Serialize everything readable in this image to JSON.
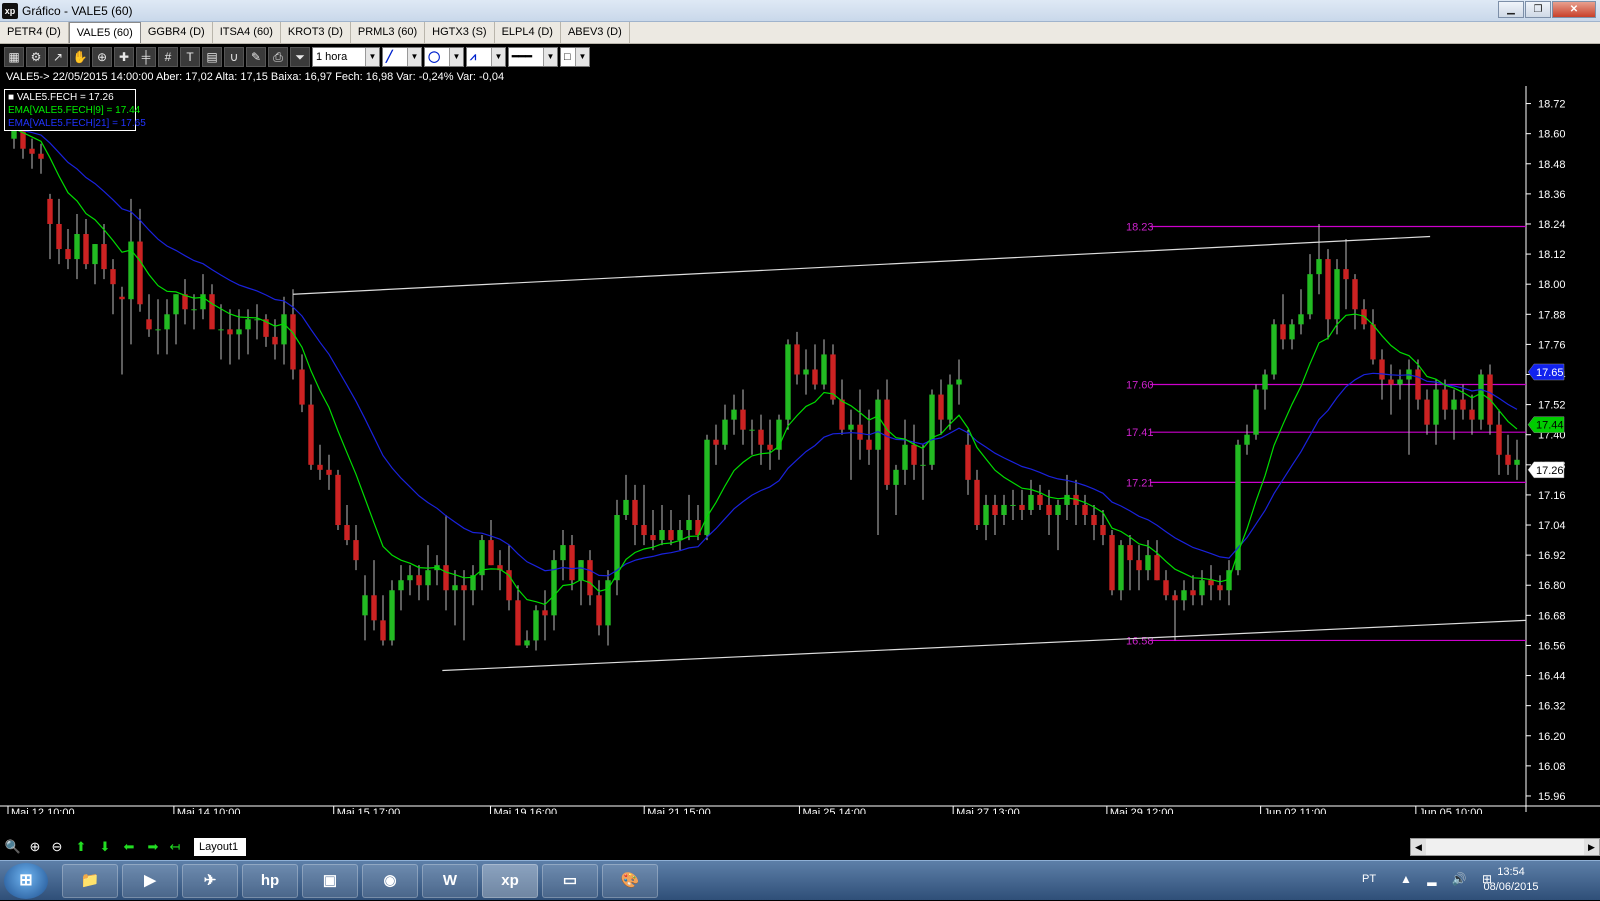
{
  "window": {
    "title": "Gráfico - VALE5 (60)",
    "logo": "xp"
  },
  "tabs": [
    {
      "label": "PETR4 (D)",
      "active": false
    },
    {
      "label": "VALE5 (60)",
      "active": true
    },
    {
      "label": "GGBR4 (D)",
      "active": false
    },
    {
      "label": "ITSA4 (60)",
      "active": false
    },
    {
      "label": "KROT3 (D)",
      "active": false
    },
    {
      "label": "PRML3 (60)",
      "active": false
    },
    {
      "label": "HGTX3 (S)",
      "active": false
    },
    {
      "label": "ELPL4 (D)",
      "active": false
    },
    {
      "label": "ABEV3 (D)",
      "active": false
    }
  ],
  "toolbar": {
    "interval": "1 hora"
  },
  "info_line": "VALE5-> 22/05/2015 14:00:00 Aber: 17,02 Alta: 17,15 Baixa: 16,97 Fech: 16,98 Var: -0,24% Var: -0,04",
  "legend": [
    {
      "text": "■ VALE5.FECH = 17.26",
      "color": "#ffffff"
    },
    {
      "text": "EMA[VALE5.FECH|9] = 17.44",
      "color": "#00ee00"
    },
    {
      "text": "EMA[VALE5.FECH|21] = 17.65",
      "color": "#2233ff"
    }
  ],
  "bottom": {
    "layout_tab": "Layout1"
  },
  "tray": {
    "lang": "PT",
    "time": "13:54",
    "date": "08/06/2015"
  },
  "chart_data": {
    "type": "candlestick",
    "y_ticks": [
      "18.72",
      "18.60",
      "18.48",
      "18.36",
      "18.24",
      "18.12",
      "18.00",
      "17.88",
      "17.76",
      "17.64",
      "17.52",
      "17.40",
      "17.28",
      "17.16",
      "17.04",
      "16.92",
      "16.80",
      "16.68",
      "16.56",
      "16.44",
      "16.32",
      "16.20",
      "16.08",
      "15.96"
    ],
    "ylim": [
      15.92,
      18.79
    ],
    "x_labels": [
      "Mai 12 10:00",
      "Mai 14 10:00",
      "Mai 15 17:00",
      "Mai 19 16:00",
      "Mai 21 15:00",
      "Mai 25 14:00",
      "Mai 27 13:00",
      "Mai 29 12:00",
      "Jun 02 11:00",
      "Jun 05 10:00"
    ],
    "h_levels": [
      {
        "value": 18.23,
        "label": "18.23"
      },
      {
        "value": 17.6,
        "label": "17.60"
      },
      {
        "value": 17.41,
        "label": "17.41"
      },
      {
        "value": 17.21,
        "label": "17.21"
      },
      {
        "value": 16.58,
        "label": "16.58"
      }
    ],
    "price_badges": [
      {
        "value": 17.65,
        "label": "17.65",
        "bg": "#1122ee",
        "fg": "#ffffff"
      },
      {
        "value": 17.44,
        "label": "17.44",
        "bg": "#00cc00",
        "fg": "#000000"
      },
      {
        "value": 17.26,
        "label": "17.26",
        "bg": "#ffffff",
        "fg": "#000000"
      }
    ],
    "trendlines": [
      {
        "x1": 0.19,
        "y1": 17.96,
        "x2": 0.937,
        "y2": 18.19
      },
      {
        "x1": 0.288,
        "y1": 16.46,
        "x2": 1.0,
        "y2": 16.66
      }
    ],
    "candles": [
      [
        18.58,
        18.66,
        18.54,
        18.62
      ],
      [
        18.62,
        18.68,
        18.5,
        18.54
      ],
      [
        18.54,
        18.58,
        18.46,
        18.52
      ],
      [
        18.52,
        18.56,
        18.44,
        18.5
      ],
      [
        18.34,
        18.36,
        18.1,
        18.24
      ],
      [
        18.24,
        18.34,
        18.08,
        18.14
      ],
      [
        18.14,
        18.22,
        18.06,
        18.1
      ],
      [
        18.1,
        18.28,
        18.02,
        18.2
      ],
      [
        18.2,
        18.26,
        18.06,
        18.08
      ],
      [
        18.08,
        18.16,
        18.0,
        18.16
      ],
      [
        18.16,
        18.24,
        18.02,
        18.06
      ],
      [
        18.06,
        18.1,
        17.88,
        18.0
      ],
      [
        17.95,
        17.99,
        17.64,
        17.94
      ],
      [
        17.94,
        18.34,
        17.76,
        18.17
      ],
      [
        18.17,
        18.3,
        17.89,
        17.92
      ],
      [
        17.86,
        17.96,
        17.79,
        17.82
      ],
      [
        17.82,
        17.94,
        17.72,
        17.82
      ],
      [
        17.82,
        17.94,
        17.72,
        17.88
      ],
      [
        17.88,
        17.96,
        17.76,
        17.96
      ],
      [
        17.96,
        18.02,
        17.84,
        17.9
      ],
      [
        17.9,
        17.96,
        17.82,
        17.9
      ],
      [
        17.9,
        18.04,
        17.86,
        17.96
      ],
      [
        17.96,
        18.0,
        17.84,
        17.82
      ],
      [
        17.82,
        17.92,
        17.7,
        17.82
      ],
      [
        17.82,
        17.9,
        17.68,
        17.8
      ],
      [
        17.8,
        17.9,
        17.7,
        17.82
      ],
      [
        17.82,
        17.9,
        17.72,
        17.86
      ],
      [
        17.86,
        17.92,
        17.78,
        17.86
      ],
      [
        17.86,
        17.88,
        17.75,
        17.79
      ],
      [
        17.79,
        17.86,
        17.7,
        17.76
      ],
      [
        17.76,
        17.95,
        17.68,
        17.88
      ],
      [
        17.88,
        17.98,
        17.62,
        17.66
      ],
      [
        17.66,
        17.72,
        17.49,
        17.52
      ],
      [
        17.52,
        17.6,
        17.26,
        17.28
      ],
      [
        17.28,
        17.36,
        17.22,
        17.26
      ],
      [
        17.26,
        17.32,
        17.18,
        17.24
      ],
      [
        17.24,
        17.26,
        17.02,
        17.04
      ],
      [
        17.04,
        17.12,
        16.96,
        16.98
      ],
      [
        16.98,
        17.04,
        16.86,
        16.9
      ],
      [
        16.68,
        16.84,
        16.58,
        16.76
      ],
      [
        16.76,
        16.9,
        16.62,
        16.66
      ],
      [
        16.66,
        16.76,
        16.56,
        16.58
      ],
      [
        16.58,
        16.82,
        16.56,
        16.78
      ],
      [
        16.78,
        16.88,
        16.7,
        16.82
      ],
      [
        16.82,
        16.88,
        16.76,
        16.84
      ],
      [
        16.84,
        16.88,
        16.74,
        16.8
      ],
      [
        16.8,
        16.96,
        16.74,
        16.86
      ],
      [
        16.86,
        16.92,
        16.8,
        16.88
      ],
      [
        16.88,
        17.08,
        16.7,
        16.78
      ],
      [
        16.78,
        16.86,
        16.64,
        16.8
      ],
      [
        16.8,
        16.86,
        16.58,
        16.78
      ],
      [
        16.78,
        16.88,
        16.72,
        16.84
      ],
      [
        16.84,
        17.0,
        16.78,
        16.98
      ],
      [
        16.98,
        17.06,
        16.88,
        16.88
      ],
      [
        16.88,
        16.94,
        16.78,
        16.86
      ],
      [
        16.86,
        16.96,
        16.7,
        16.74
      ],
      [
        16.74,
        16.8,
        16.56,
        16.56
      ],
      [
        16.56,
        16.62,
        16.55,
        16.58
      ],
      [
        16.58,
        16.72,
        16.54,
        16.7
      ],
      [
        16.7,
        16.78,
        16.58,
        16.68
      ],
      [
        16.68,
        16.94,
        16.62,
        16.9
      ],
      [
        16.9,
        17.02,
        16.82,
        16.96
      ],
      [
        16.96,
        17.0,
        16.78,
        16.82
      ],
      [
        16.82,
        16.9,
        16.72,
        16.9
      ],
      [
        16.9,
        16.94,
        16.72,
        16.76
      ],
      [
        16.76,
        16.82,
        16.6,
        16.64
      ],
      [
        16.64,
        16.86,
        16.56,
        16.82
      ],
      [
        16.82,
        17.14,
        16.76,
        17.08
      ],
      [
        17.08,
        17.24,
        17.06,
        17.14
      ],
      [
        17.14,
        17.2,
        16.96,
        17.04
      ],
      [
        17.04,
        17.2,
        16.96,
        17.0
      ],
      [
        17.0,
        17.1,
        16.94,
        16.98
      ],
      [
        16.98,
        17.12,
        16.96,
        17.02
      ],
      [
        17.02,
        17.1,
        16.96,
        16.98
      ],
      [
        16.98,
        17.06,
        16.94,
        17.02
      ],
      [
        17.02,
        17.16,
        16.98,
        17.06
      ],
      [
        17.06,
        17.12,
        16.98,
        17.0
      ],
      [
        17.0,
        17.4,
        16.98,
        17.38
      ],
      [
        17.38,
        17.44,
        17.28,
        17.36
      ],
      [
        17.36,
        17.52,
        17.34,
        17.46
      ],
      [
        17.46,
        17.56,
        17.4,
        17.5
      ],
      [
        17.5,
        17.58,
        17.36,
        17.42
      ],
      [
        17.42,
        17.46,
        17.32,
        17.42
      ],
      [
        17.42,
        17.48,
        17.28,
        17.36
      ],
      [
        17.36,
        17.46,
        17.26,
        17.34
      ],
      [
        17.34,
        17.48,
        17.3,
        17.46
      ],
      [
        17.46,
        17.78,
        17.42,
        17.76
      ],
      [
        17.76,
        17.81,
        17.6,
        17.64
      ],
      [
        17.64,
        17.74,
        17.56,
        17.66
      ],
      [
        17.66,
        17.76,
        17.58,
        17.6
      ],
      [
        17.6,
        17.78,
        17.58,
        17.72
      ],
      [
        17.72,
        17.76,
        17.52,
        17.54
      ],
      [
        17.54,
        17.62,
        17.4,
        17.42
      ],
      [
        17.42,
        17.5,
        17.22,
        17.44
      ],
      [
        17.44,
        17.58,
        17.3,
        17.38
      ],
      [
        17.38,
        17.5,
        17.28,
        17.34
      ],
      [
        17.34,
        17.58,
        17.0,
        17.54
      ],
      [
        17.54,
        17.62,
        17.18,
        17.2
      ],
      [
        17.2,
        17.28,
        17.08,
        17.26
      ],
      [
        17.26,
        17.46,
        17.2,
        17.36
      ],
      [
        17.36,
        17.44,
        17.22,
        17.28
      ],
      [
        17.28,
        17.36,
        17.14,
        17.28
      ],
      [
        17.28,
        17.58,
        17.26,
        17.56
      ],
      [
        17.56,
        17.62,
        17.4,
        17.46
      ],
      [
        17.46,
        17.64,
        17.42,
        17.6
      ],
      [
        17.6,
        17.7,
        17.52,
        17.62
      ],
      [
        17.36,
        17.42,
        17.16,
        17.22
      ],
      [
        17.22,
        17.26,
        17.02,
        17.04
      ],
      [
        17.04,
        17.16,
        16.98,
        17.12
      ],
      [
        17.12,
        17.16,
        17.0,
        17.08
      ],
      [
        17.08,
        17.16,
        17.04,
        17.12
      ],
      [
        17.12,
        17.18,
        17.06,
        17.12
      ],
      [
        17.12,
        17.18,
        17.06,
        17.1
      ],
      [
        17.1,
        17.22,
        17.08,
        17.16
      ],
      [
        17.16,
        17.2,
        17.1,
        17.12
      ],
      [
        17.12,
        17.18,
        17.0,
        17.08
      ],
      [
        17.08,
        17.14,
        16.94,
        17.12
      ],
      [
        17.12,
        17.24,
        17.06,
        17.16
      ],
      [
        17.16,
        17.22,
        17.04,
        17.12
      ],
      [
        17.12,
        17.16,
        17.04,
        17.08
      ],
      [
        17.08,
        17.12,
        16.98,
        17.04
      ],
      [
        17.04,
        17.1,
        16.96,
        17.0
      ],
      [
        17.0,
        17.02,
        16.76,
        16.78
      ],
      [
        16.78,
        16.98,
        16.74,
        16.96
      ],
      [
        16.96,
        17.0,
        16.78,
        16.9
      ],
      [
        16.9,
        16.96,
        16.78,
        16.86
      ],
      [
        16.86,
        16.98,
        16.82,
        16.92
      ],
      [
        16.92,
        16.98,
        16.82,
        16.82
      ],
      [
        16.82,
        16.86,
        16.74,
        16.76
      ],
      [
        16.76,
        16.78,
        16.58,
        16.74
      ],
      [
        16.74,
        16.82,
        16.7,
        16.78
      ],
      [
        16.78,
        16.84,
        16.72,
        16.76
      ],
      [
        16.76,
        16.86,
        16.72,
        16.82
      ],
      [
        16.82,
        16.88,
        16.74,
        16.8
      ],
      [
        16.8,
        16.84,
        16.74,
        16.78
      ],
      [
        16.78,
        16.9,
        16.72,
        16.86
      ],
      [
        16.86,
        17.38,
        16.84,
        17.36
      ],
      [
        17.36,
        17.44,
        17.32,
        17.4
      ],
      [
        17.4,
        17.6,
        17.38,
        17.58
      ],
      [
        17.58,
        17.66,
        17.5,
        17.64
      ],
      [
        17.64,
        17.86,
        17.62,
        17.84
      ],
      [
        17.84,
        17.96,
        17.74,
        17.78
      ],
      [
        17.78,
        17.86,
        17.74,
        17.84
      ],
      [
        17.84,
        17.98,
        17.8,
        17.88
      ],
      [
        17.88,
        18.12,
        17.86,
        18.04
      ],
      [
        18.04,
        18.24,
        17.96,
        18.1
      ],
      [
        18.1,
        18.14,
        17.78,
        17.86
      ],
      [
        17.86,
        18.1,
        17.8,
        18.06
      ],
      [
        18.06,
        18.18,
        17.9,
        18.02
      ],
      [
        18.02,
        18.04,
        17.82,
        17.9
      ],
      [
        17.9,
        17.94,
        17.82,
        17.84
      ],
      [
        17.84,
        17.9,
        17.68,
        17.7
      ],
      [
        17.7,
        17.74,
        17.54,
        17.62
      ],
      [
        17.62,
        17.68,
        17.48,
        17.6
      ],
      [
        17.6,
        17.66,
        17.54,
        17.62
      ],
      [
        17.62,
        17.7,
        17.32,
        17.66
      ],
      [
        17.66,
        17.7,
        17.5,
        17.54
      ],
      [
        17.54,
        17.58,
        17.4,
        17.44
      ],
      [
        17.44,
        17.62,
        17.36,
        17.58
      ],
      [
        17.58,
        17.62,
        17.46,
        17.5
      ],
      [
        17.5,
        17.58,
        17.38,
        17.54
      ],
      [
        17.54,
        17.6,
        17.46,
        17.5
      ],
      [
        17.5,
        17.56,
        17.4,
        17.46
      ],
      [
        17.46,
        17.66,
        17.42,
        17.64
      ],
      [
        17.64,
        17.68,
        17.4,
        17.44
      ],
      [
        17.44,
        17.5,
        17.24,
        17.32
      ],
      [
        17.32,
        17.4,
        17.24,
        17.28
      ],
      [
        17.28,
        17.38,
        17.22,
        17.3
      ]
    ]
  }
}
